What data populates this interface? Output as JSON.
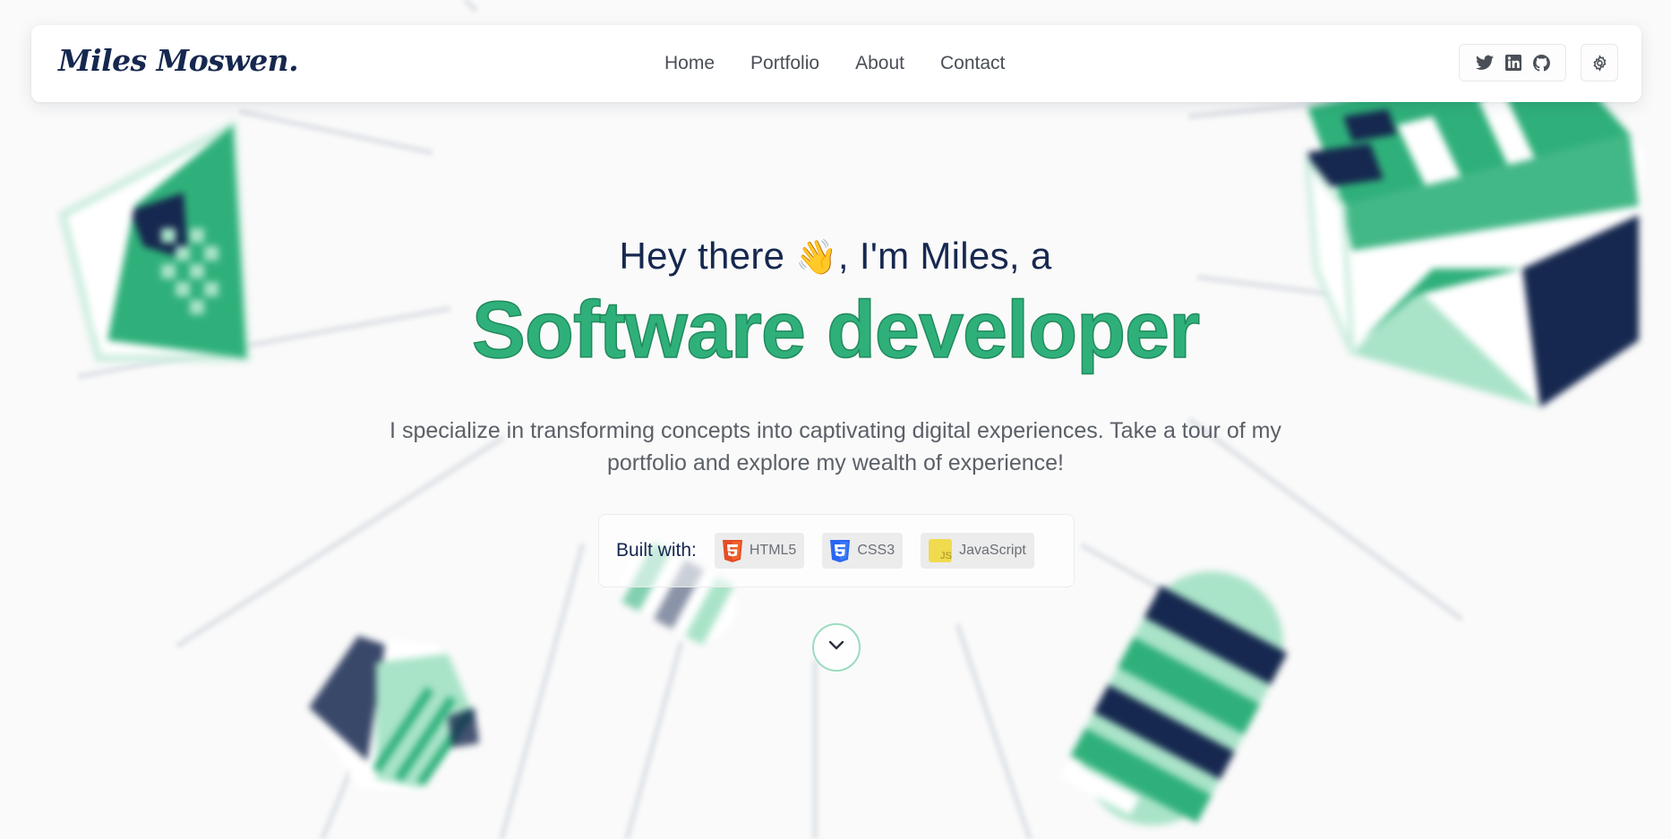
{
  "nav": {
    "logo": "Miles Moswen.",
    "links": [
      "Home",
      "Portfolio",
      "About",
      "Contact"
    ],
    "social_icons": [
      "twitter-icon",
      "linkedin-icon",
      "github-icon"
    ],
    "settings_icon": "gear-icon"
  },
  "hero": {
    "greeting_before": "Hey there",
    "greeting_emoji": "👋",
    "greeting_after": ", I'm Miles, a",
    "title": "Software developer",
    "description": "I specialize in transforming concepts into captivating digital experiences. Take a tour of my portfolio and explore my wealth of experience!"
  },
  "built_with": {
    "label": "Built with:",
    "items": [
      {
        "name": "HTML5",
        "icon": "html5-icon",
        "color": "#e44d26"
      },
      {
        "name": "CSS3",
        "icon": "css3-icon",
        "color": "#2965f1"
      },
      {
        "name": "JavaScript",
        "icon": "javascript-icon",
        "color": "#f0db4f"
      }
    ]
  },
  "scroll_icon": "chevron-down-icon",
  "colors": {
    "accent": "#2fb07a",
    "navy": "#16284f",
    "mint": "#a9e3c8"
  }
}
